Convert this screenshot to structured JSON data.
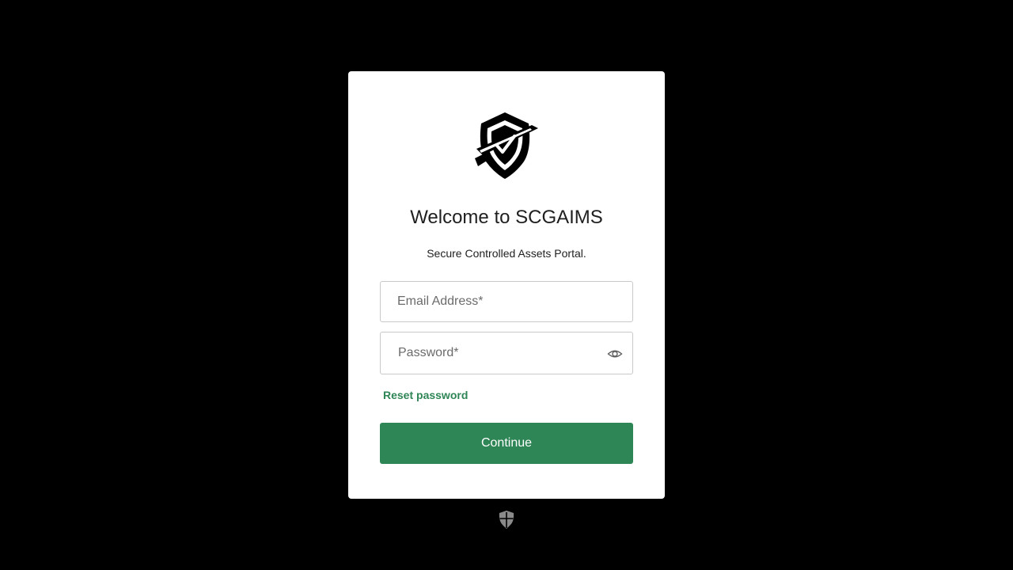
{
  "login": {
    "title": "Welcome to SCGAIMS",
    "subtitle": "Secure Controlled Assets Portal.",
    "email_placeholder": "Email Address*",
    "email_value": "",
    "password_placeholder": "Password*",
    "password_value": "",
    "reset_label": "Reset password",
    "continue_label": "Continue"
  },
  "icons": {
    "logo": "shield-logo-icon",
    "password_toggle": "eye-icon",
    "footer": "shield-footer-icon"
  },
  "colors": {
    "background": "#000000",
    "card": "#ffffff",
    "accent": "#2e8555",
    "text": "#1f1f1f",
    "placeholder": "#6b6b6b",
    "border": "#c9c9c9",
    "footer_icon": "#8a8a8a"
  }
}
